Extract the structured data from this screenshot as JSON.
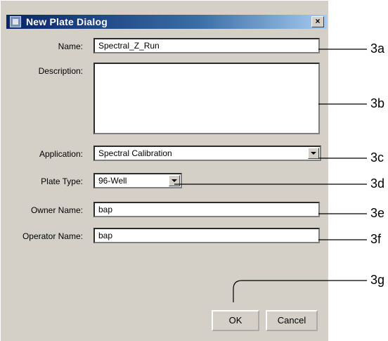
{
  "dialog": {
    "title": "New Plate Dialog",
    "close_label": "×",
    "ok_label": "OK",
    "cancel_label": "Cancel"
  },
  "fields": {
    "name": {
      "label": "Name:",
      "value": "Spectral_Z_Run"
    },
    "description": {
      "label": "Description:",
      "value": ""
    },
    "application": {
      "label": "Application:",
      "value": "Spectral Calibration"
    },
    "plate_type": {
      "label": "Plate Type:",
      "value": "96-Well"
    },
    "owner": {
      "label": "Owner Name:",
      "value": "bap"
    },
    "operator": {
      "label": "Operator Name:",
      "value": "bap"
    }
  },
  "callouts": [
    "3a",
    "3b",
    "3c",
    "3d",
    "3e",
    "3f",
    "3g"
  ]
}
